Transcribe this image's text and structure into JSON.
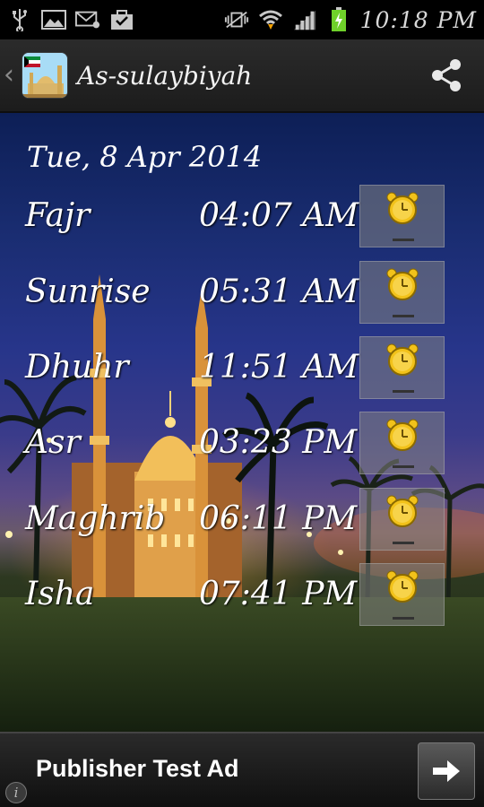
{
  "status_bar": {
    "time": "10:18 PM",
    "icons": [
      "usb-icon",
      "image-icon",
      "email-icon",
      "bag-icon",
      "mute-vibrate-icon",
      "wifi-icon",
      "signal-icon",
      "battery-charging-icon"
    ]
  },
  "action_bar": {
    "title": "As-sulaybiyah",
    "share_icon": "share-icon"
  },
  "main": {
    "date": "Tue, 8 Apr 2014",
    "prayers": [
      {
        "name": "Fajr",
        "time": "04:07 AM"
      },
      {
        "name": "Sunrise",
        "time": "05:31 AM"
      },
      {
        "name": "Dhuhr",
        "time": "11:51 AM"
      },
      {
        "name": "Asr",
        "time": "03:23 PM"
      },
      {
        "name": "Maghrib",
        "time": "06:11 PM"
      },
      {
        "name": "Isha",
        "time": "07:41 PM"
      }
    ]
  },
  "ad": {
    "text": "Publisher Test Ad",
    "info": "i"
  },
  "colors": {
    "alarm_clock": "#f2c21a",
    "sky_top": "#0d1f56",
    "ground": "#213018"
  }
}
